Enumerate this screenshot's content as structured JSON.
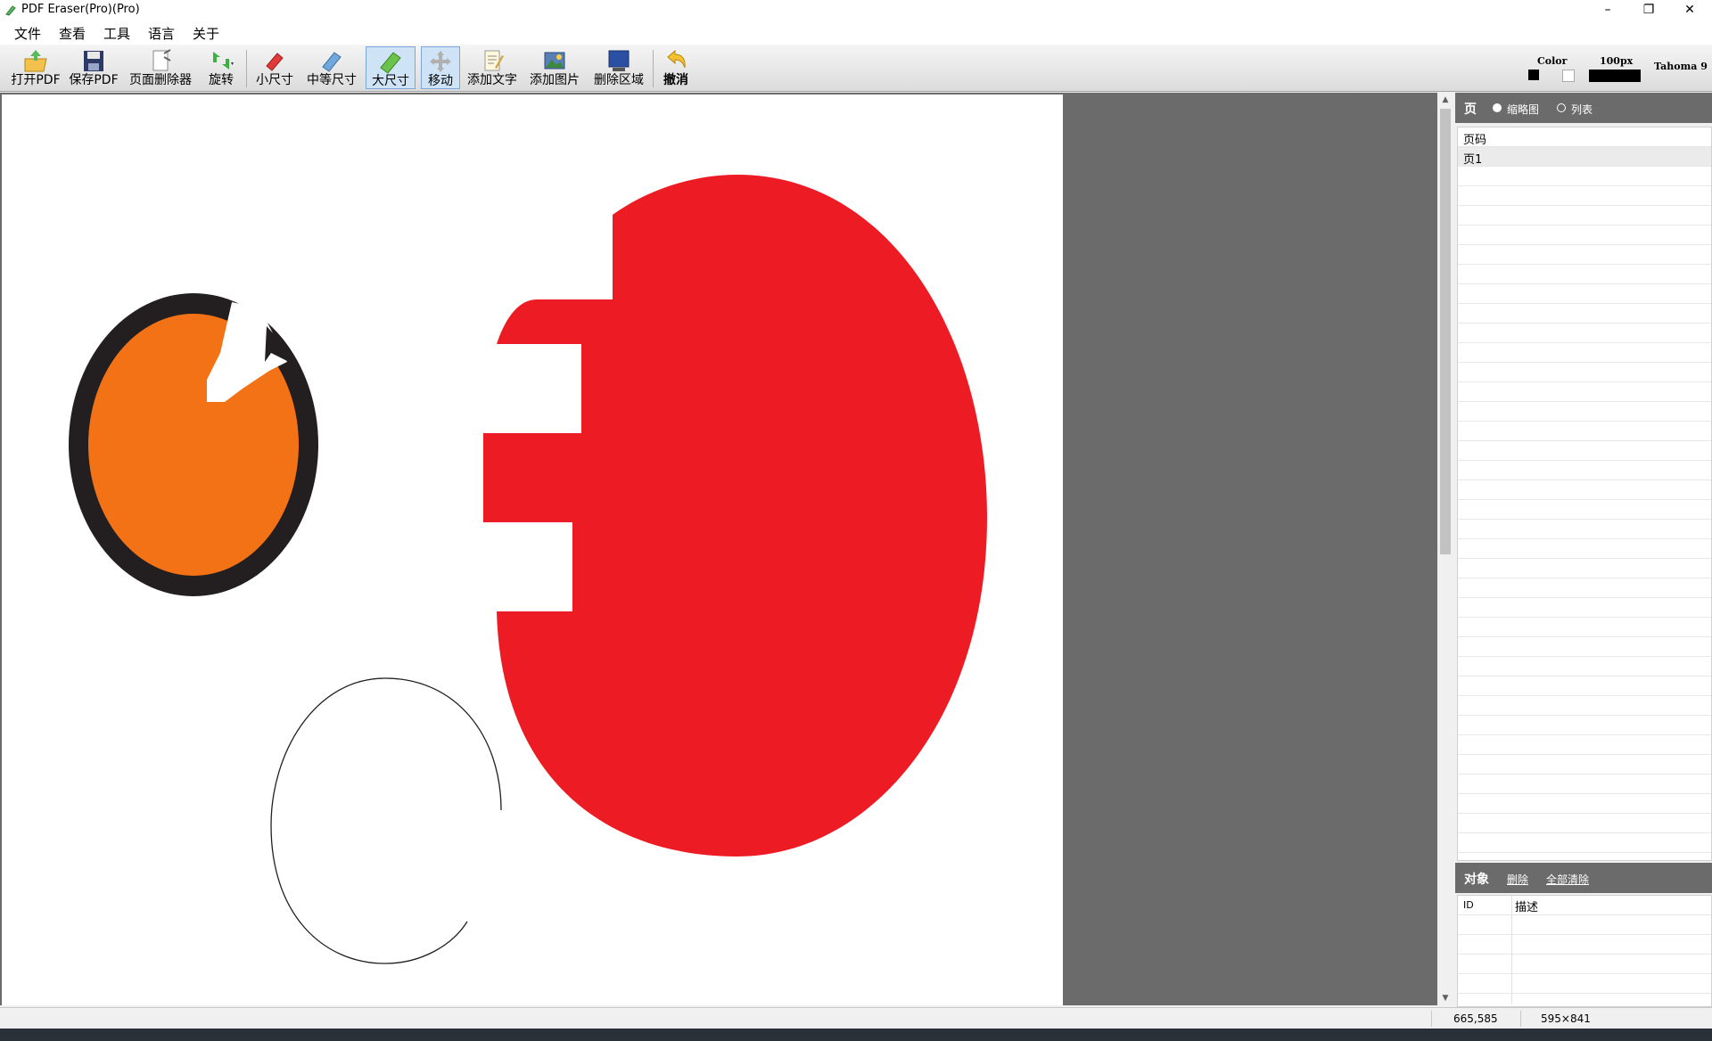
{
  "window": {
    "title": "PDF Eraser(Pro)(Pro)",
    "minimize": "–",
    "restore": "❐",
    "close": "✕"
  },
  "menu": [
    "文件",
    "查看",
    "工具",
    "语言",
    "关于"
  ],
  "toolbar": {
    "open_pdf": "打开PDF",
    "save_pdf": "保存PDF",
    "page_remover": "页面删除器",
    "rotate": "旋转",
    "small_size": "小尺寸",
    "medium_size": "中等尺寸",
    "large_size": "大尺寸",
    "move": "移动",
    "add_text": "添加文字",
    "add_image": "添加图片",
    "delete_area": "删除区域",
    "undo": "撤消",
    "color_label": "Color",
    "size_label": "100px",
    "font_label": "Tahoma 9"
  },
  "pages_panel": {
    "title": "页",
    "thumbnail_option": "缩略图",
    "list_option": "列表",
    "column_header": "页码",
    "rows": [
      "页1"
    ]
  },
  "objects_panel": {
    "title": "对象",
    "delete_link": "删除",
    "clear_all_link": "全部清除",
    "columns": [
      "ID",
      "描述"
    ]
  },
  "status": {
    "coords": "665,585",
    "page_size": "595×841"
  },
  "colors": {
    "red_shape": "#ed1c24",
    "orange_shape": "#f47216",
    "ring": "#231f20",
    "canvas_bg": "#6b6b6b"
  },
  "icons": [
    "pdf-eraser-app-icon",
    "open-folder-icon",
    "save-disk-icon",
    "page-remover-icon",
    "rotate-icon",
    "small-eraser-icon",
    "medium-eraser-icon",
    "large-eraser-icon",
    "move-arrows-icon",
    "add-text-icon",
    "add-image-icon",
    "delete-area-icon",
    "undo-icon"
  ]
}
